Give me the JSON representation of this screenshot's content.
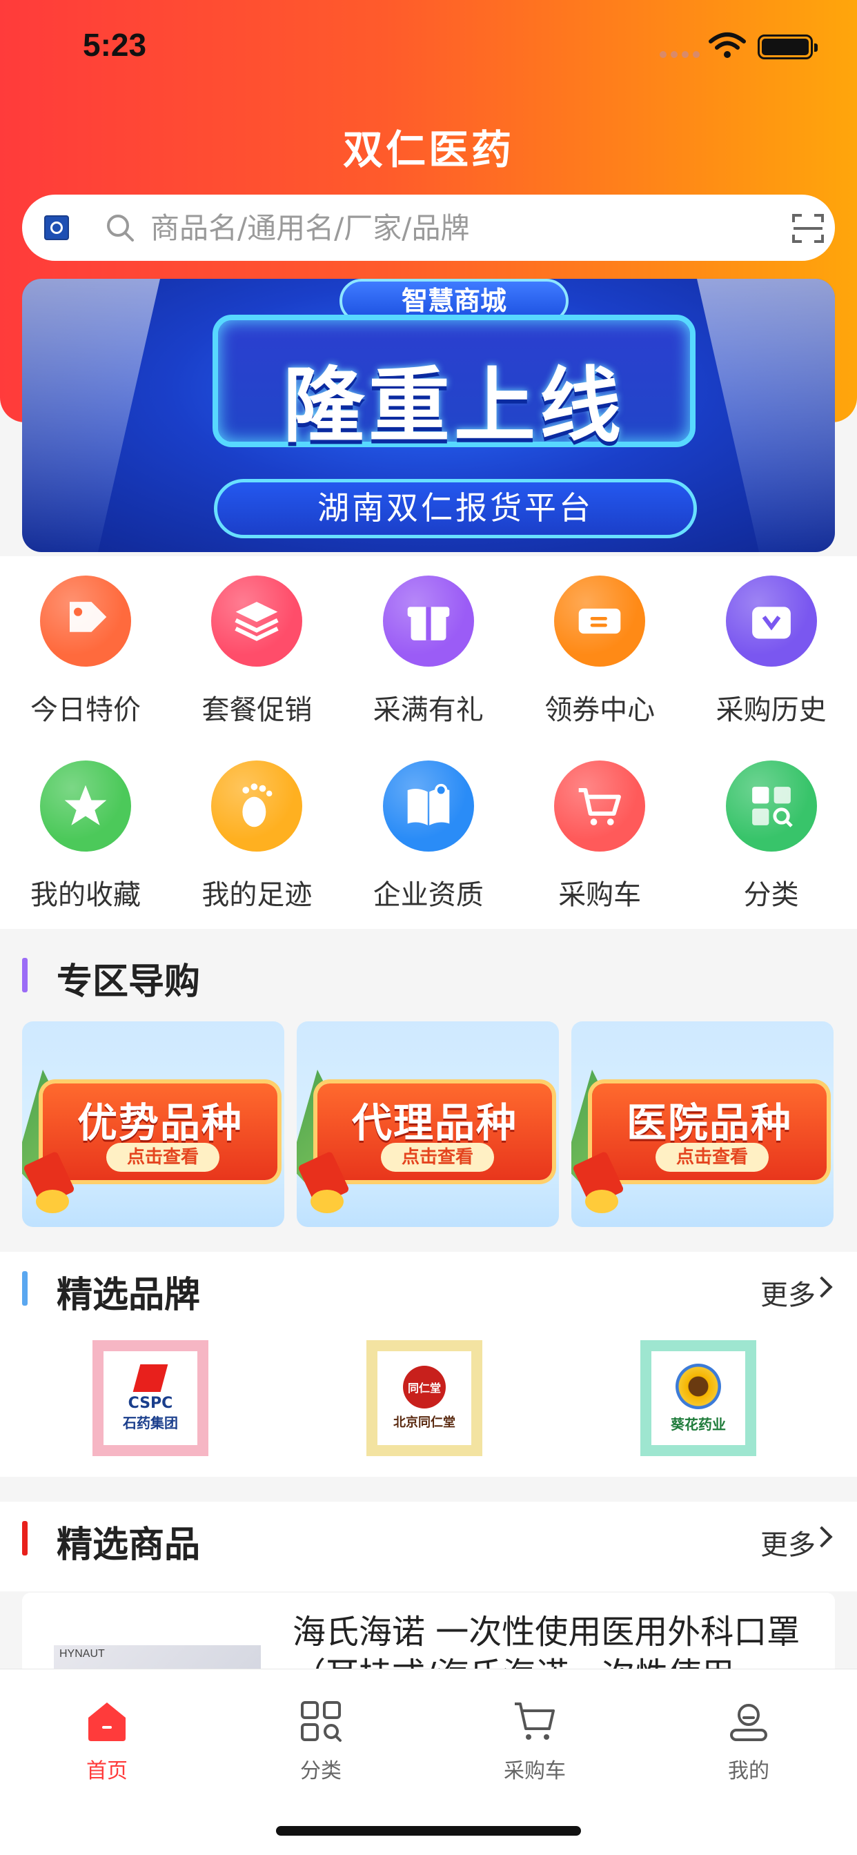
{
  "status_bar": {
    "time": "5:23"
  },
  "header": {
    "title": "双仁医药"
  },
  "search": {
    "placeholder": "商品名/通用名/厂家/品牌"
  },
  "banner": {
    "top_pill": "智慧商城",
    "headline": "隆重上线",
    "subtitle": "湖南双仁报货平台"
  },
  "quick_actions": [
    {
      "label": "今日特价",
      "icon": "tag-icon",
      "color": "#ff6a3d"
    },
    {
      "label": "套餐促销",
      "icon": "layers-icon",
      "color": "#ff4d6a"
    },
    {
      "label": "采满有礼",
      "icon": "gift-icon",
      "color": "#9b5cf6"
    },
    {
      "label": "领券中心",
      "icon": "ticket-icon",
      "color": "#ff8a16"
    },
    {
      "label": "采购历史",
      "icon": "bag-icon",
      "color": "#7a57f0"
    },
    {
      "label": "我的收藏",
      "icon": "star-icon",
      "color": "#4cc95a"
    },
    {
      "label": "我的足迹",
      "icon": "footprint-icon",
      "color": "#ffb020"
    },
    {
      "label": "企业资质",
      "icon": "book-icon",
      "color": "#2a8cf7"
    },
    {
      "label": "采购车",
      "icon": "cart-icon",
      "color": "#ff5a5a"
    },
    {
      "label": "分类",
      "icon": "category-icon",
      "color": "#38c46a"
    }
  ],
  "zones": {
    "title": "专区导购",
    "accent": "#9b6cf6",
    "cards": [
      {
        "label": "优势品种",
        "button": "点击查看"
      },
      {
        "label": "代理品种",
        "button": "点击查看"
      },
      {
        "label": "医院品种",
        "button": "点击查看"
      }
    ]
  },
  "brands": {
    "title": "精选品牌",
    "more": "更多",
    "accent": "#5aa7f0",
    "items": [
      {
        "line1": "CSPC",
        "line2": "石药集团",
        "frame": "#f6b6c4"
      },
      {
        "line1": "同仁堂",
        "line2": "北京同仁堂",
        "frame": "#f3e3a1"
      },
      {
        "line1": "",
        "line2": "葵花药业",
        "frame": "#9ee6d0"
      }
    ]
  },
  "products": {
    "title": "精选商品",
    "more": "更多",
    "accent": "#e8201c",
    "items": [
      {
        "name": "海氏海诺 一次性使用医用外科口罩（耳挂式/海氏海诺一次性使用",
        "image_text": "HYNAUT"
      }
    ]
  },
  "tab_bar": {
    "active_color": "#ff3b3b",
    "tabs": [
      {
        "label": "首页",
        "icon": "home-icon",
        "active": true
      },
      {
        "label": "分类",
        "icon": "grid-search-icon",
        "active": false
      },
      {
        "label": "采购车",
        "icon": "cart-icon",
        "active": false
      },
      {
        "label": "我的",
        "icon": "profile-icon",
        "active": false
      }
    ]
  }
}
